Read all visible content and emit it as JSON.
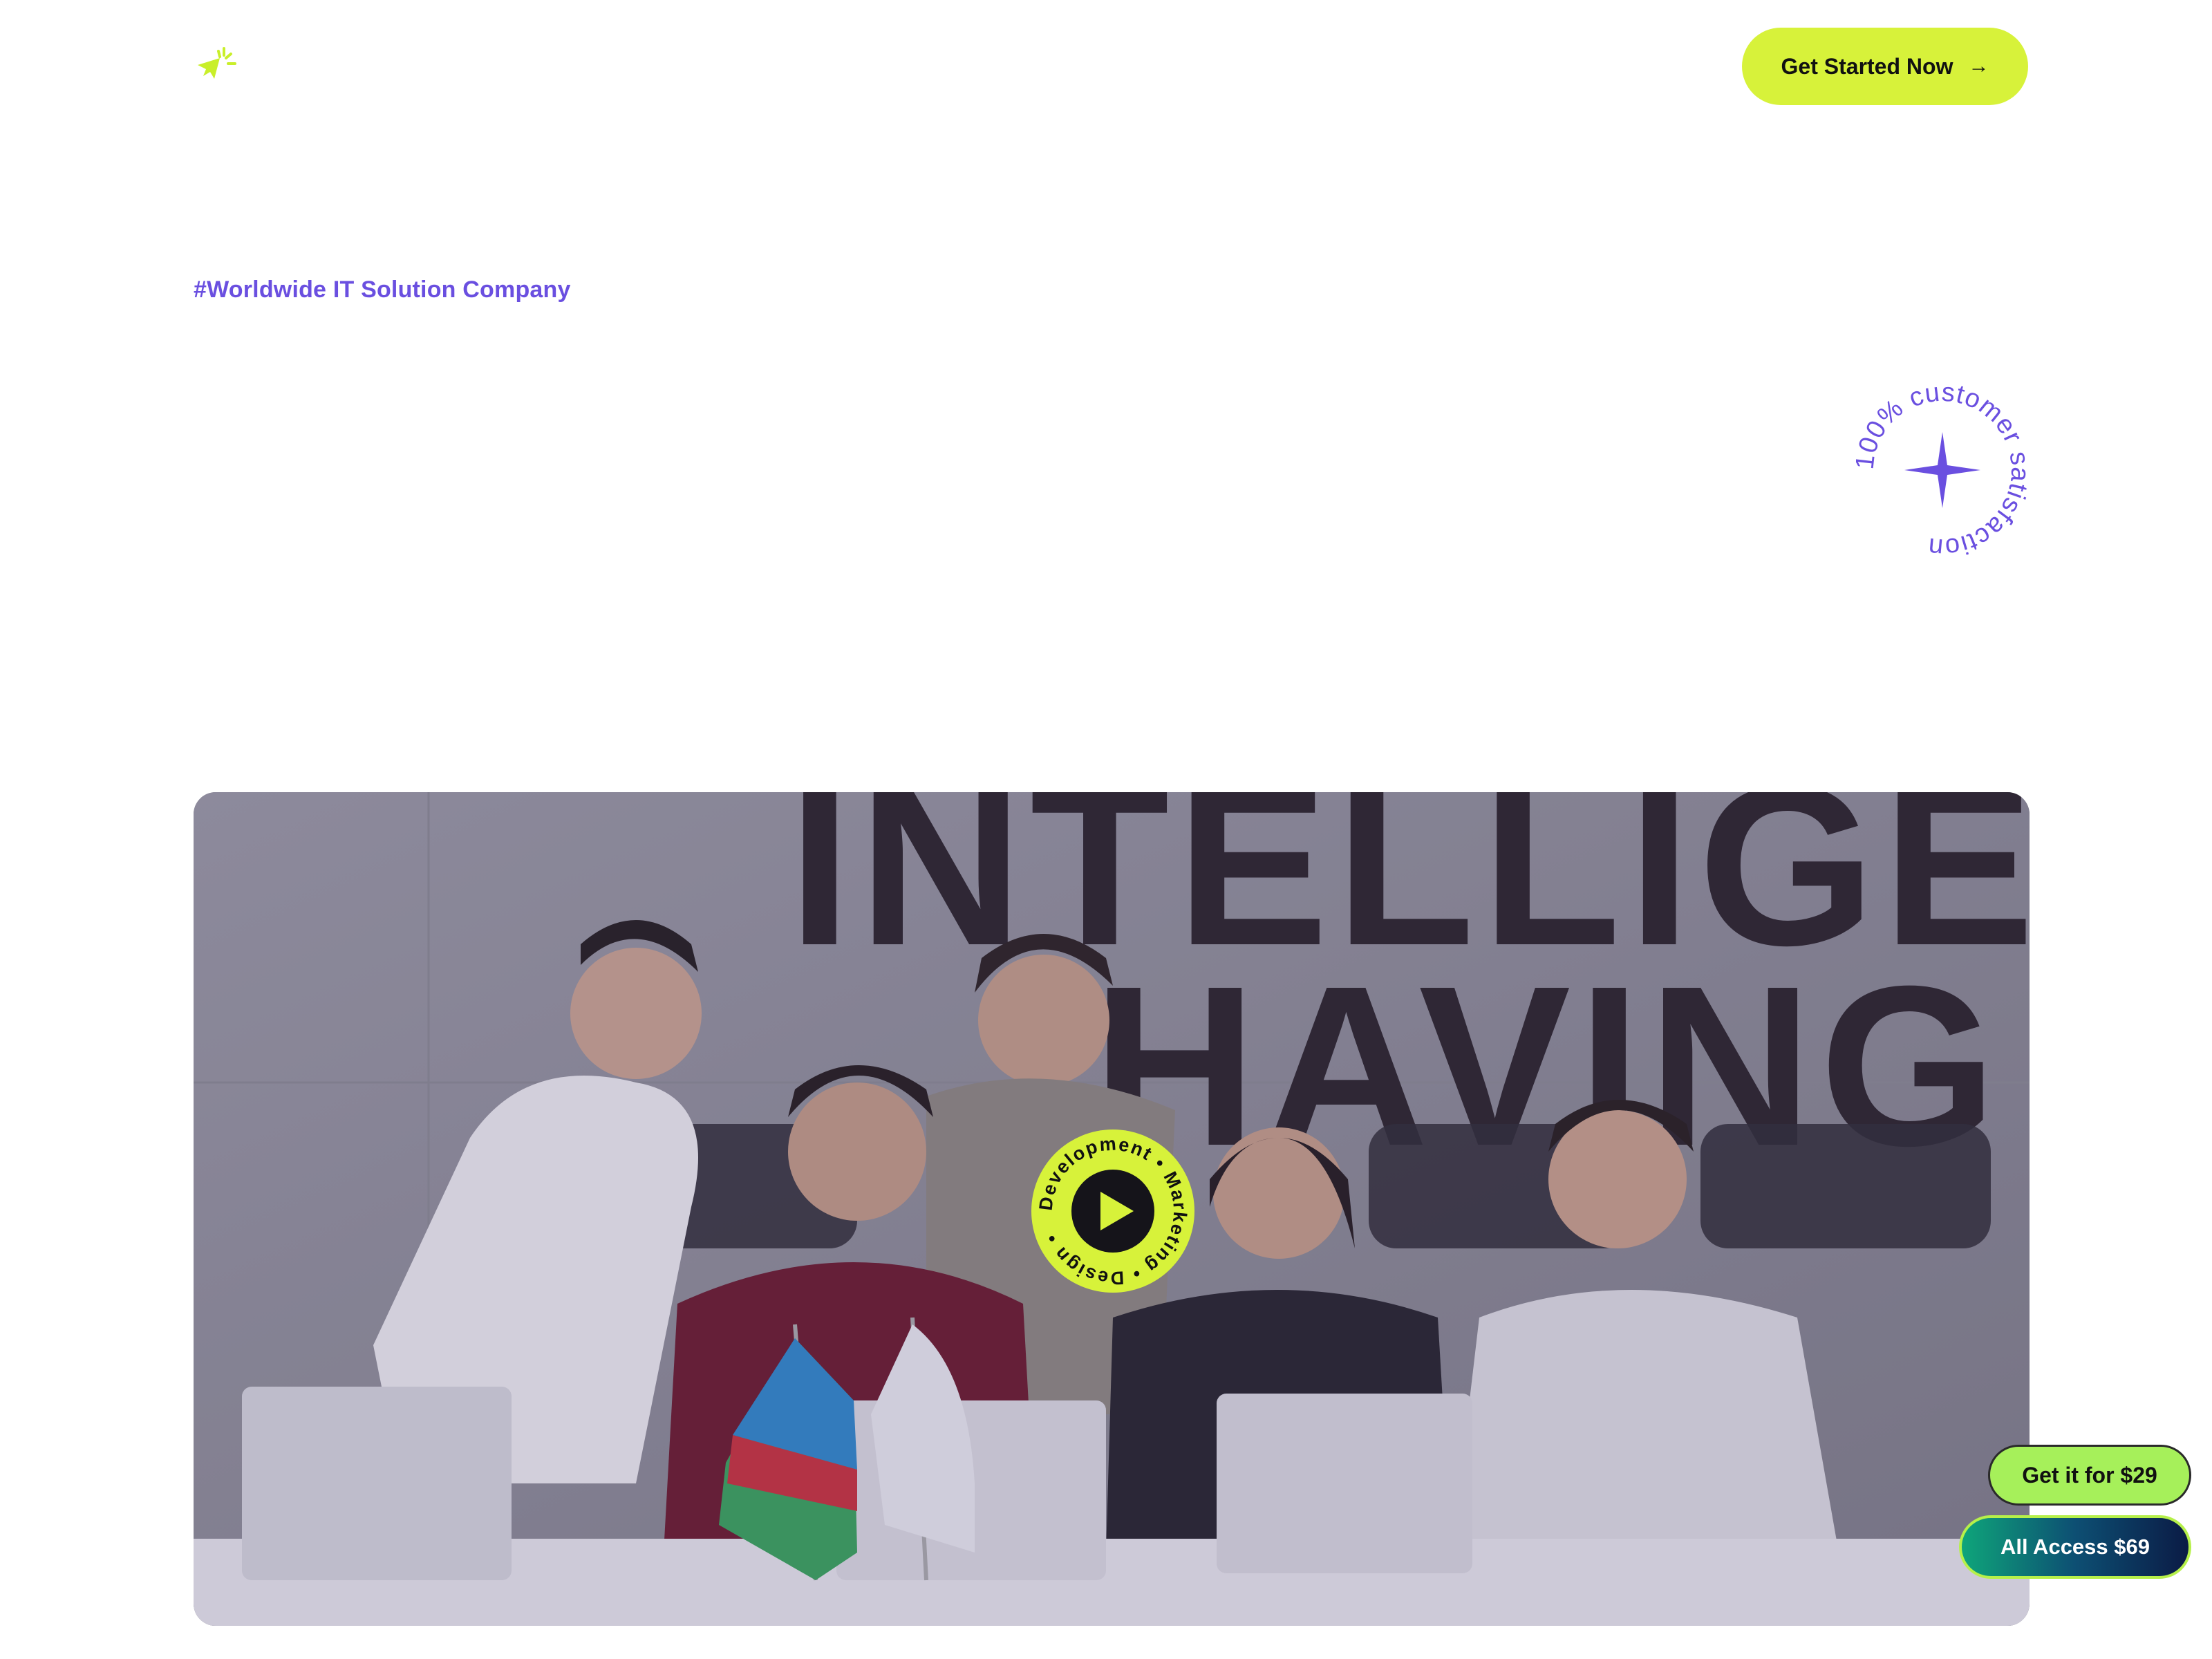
{
  "header": {
    "logo_icon": "megaphone-icon",
    "cta_label": "Get Started Now",
    "cta_icon": "arrow-right-icon"
  },
  "hero": {
    "tagline": "#Worldwide IT Solution Company",
    "badge_text": "100% customer satisfaction",
    "badge_icon": "sparkle-icon"
  },
  "image": {
    "wall_letters_top": "INTELLIGEN",
    "wall_letters_bottom": "HAVING",
    "play_badge_text": "Development • Marketing • Design • ",
    "play_icon": "play-icon"
  },
  "purchase": {
    "basic_label": "Get it for $29",
    "all_access_label": "All Access $69"
  },
  "colors": {
    "accent_lime": "#d7f23a",
    "accent_purple": "#6a4fe0",
    "green_button": "#a6f05a"
  }
}
